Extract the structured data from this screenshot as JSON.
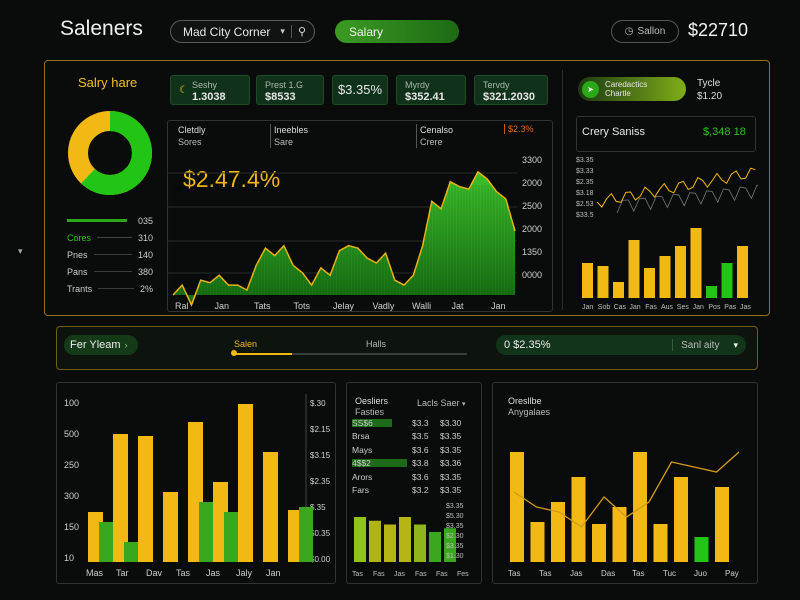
{
  "header": {
    "title": "Saleners",
    "selector_value": "Mad City Corner",
    "active_tab": "Salary",
    "status_label": "Sallon",
    "total": "$22710"
  },
  "top_panel": {
    "title": "Salry hare",
    "donut": {
      "green_pct": 62,
      "yellow_pct": 38,
      "green": "#22c416",
      "yellow": "#f2b915"
    },
    "legend": [
      {
        "label": "Cores",
        "value": "035"
      },
      {
        "label": "Cores",
        "value": "310"
      },
      {
        "label": "Pnes",
        "value": "140"
      },
      {
        "label": "Pans",
        "value": "380"
      },
      {
        "label": "Trants",
        "value": "2%"
      }
    ],
    "stat_cards": [
      {
        "label": "Seshy",
        "value": "1.3038"
      },
      {
        "label": "Prest 1.G",
        "value": "$8533"
      },
      {
        "label": "",
        "value": "$3.35%"
      },
      {
        "label": "Myrdy",
        "value": "$352.41"
      },
      {
        "label": "Tervdy",
        "value": "$321.2030"
      }
    ],
    "main_headers": [
      {
        "line1": "Cletdly",
        "line2": "Sores"
      },
      {
        "line1": "Ineebles",
        "line2": "Sare"
      },
      {
        "line1": "Cenalso",
        "line2": "Crere"
      }
    ],
    "main_flag": "$2.3%",
    "big_value": "$2.47.4%",
    "right_toggle": {
      "label1": "Caredactics",
      "label2": "Chartle"
    },
    "right_info": {
      "label": "Tycle",
      "value": "$1.20"
    },
    "crazy_title": "Crery Saniss",
    "crazy_value": "$,348 18"
  },
  "filter_bar": {
    "left_label": "Fer Yleam",
    "slider1_label": "Salen",
    "slider2_label": "Halls",
    "amount": "0 $2.35%",
    "dropdown_label": "Sanl aity"
  },
  "bottom_middle": {
    "col1_title": "Oesliers",
    "col1_sub": "Fasties",
    "col2_title": "Lacls Saer",
    "rows": [
      {
        "label": "SS$6",
        "c1": "$3.3",
        "c2": "$3.30"
      },
      {
        "label": "Brsa",
        "c1": "$3.5",
        "c2": "$3.35"
      },
      {
        "label": "Mays",
        "c1": "$3.6",
        "c2": "$3.35"
      },
      {
        "label": "4$$2",
        "c1": "$3.8",
        "c2": "$3.36"
      },
      {
        "label": "Arors",
        "c1": "$3.6",
        "c2": "$3.35"
      },
      {
        "label": "Fars",
        "c1": "$3.2",
        "c2": "$3.35"
      }
    ]
  },
  "bottom_right": {
    "title_line1": "Oresllbe",
    "title_line2": "Anygalaes"
  },
  "chart_data": [
    {
      "type": "area",
      "x": [
        "Ral",
        "Jan",
        "Tats",
        "Tots",
        "Jelay",
        "Vadly",
        "Walli",
        "Jat",
        "Jan"
      ],
      "series": [
        {
          "values": [
            280,
            340,
            300,
            540,
            310,
            450,
            900,
            850,
            320
          ]
        }
      ],
      "ylim": [
        0,
        3000
      ],
      "yticks_right": [
        "3300",
        "2000",
        "2500",
        "2000",
        "1350",
        "0000"
      ]
    },
    {
      "type": "bar",
      "categories": [
        "Jan",
        "Sob",
        "Cas",
        "Jan",
        "Fas",
        "Aus",
        "Ses",
        "Jan",
        "Pos",
        "Pas",
        "Jas"
      ],
      "values": [
        35,
        32,
        16,
        58,
        30,
        42,
        52,
        70,
        12,
        35,
        52
      ],
      "line_series": [
        55,
        58,
        60,
        62,
        68,
        72,
        70,
        80,
        85,
        88,
        90
      ],
      "yticks_left": [
        "$3.35",
        "$3.33",
        "$2.35",
        "$3.18",
        "$2.53",
        "$33.5"
      ]
    },
    {
      "type": "bar",
      "categories": [
        "Mas",
        "Tar",
        "Dav",
        "Tas",
        "Jas",
        "Jaly",
        "Jan"
      ],
      "series": [
        {
          "values": [
            50,
            128,
            126,
            70,
            140,
            80,
            158,
            110,
            52
          ]
        },
        {
          "values": [
            40,
            20,
            0,
            0,
            60,
            50,
            0,
            0,
            55
          ]
        }
      ],
      "yticks_left": [
        "100",
        "500",
        "250",
        "300",
        "150",
        "10"
      ],
      "yticks_right": [
        "$.30",
        "$2.15",
        "$3.15",
        "$2.35",
        "$.35",
        "$0.35",
        "$0.00"
      ]
    },
    {
      "type": "bar",
      "categories": [
        "Tas",
        "Fas",
        "Jas",
        "Fas",
        "Fas",
        "Fes"
      ],
      "values": [
        60,
        55,
        50,
        60,
        50,
        40,
        45
      ],
      "yticks_right": [
        "$3.35",
        "$5.30",
        "$3.35",
        "$2.30",
        "$3.35",
        "$1.30"
      ]
    },
    {
      "type": "bar",
      "categories": [
        "Tas",
        "Tas",
        "Jas",
        "Das",
        "Tas",
        "Tuc",
        "Juo",
        "Pay"
      ],
      "values": [
        110,
        40,
        60,
        85,
        38,
        55,
        110,
        38,
        85,
        25,
        75
      ],
      "line_series": [
        70,
        55,
        50,
        35,
        65,
        45,
        60,
        100,
        95,
        90,
        110
      ]
    }
  ]
}
